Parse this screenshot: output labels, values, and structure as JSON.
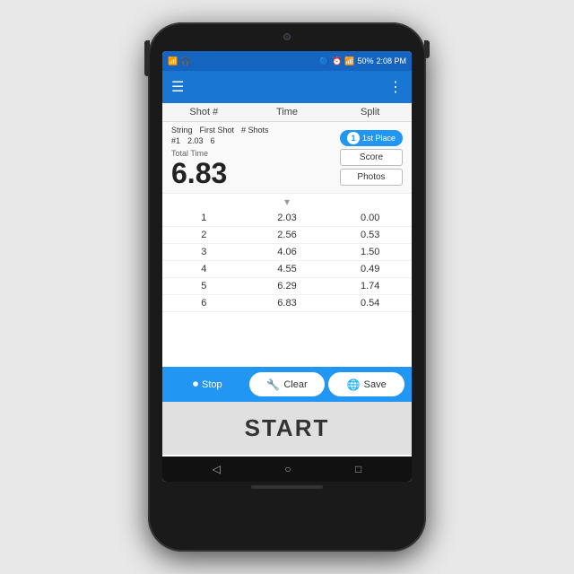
{
  "statusBar": {
    "battery": "50%",
    "time": "2:08 PM",
    "signal": "▮▮▮▮"
  },
  "actionBar": {
    "menuIcon": "☰",
    "moreIcon": "⋮"
  },
  "columnHeaders": {
    "shot": "Shot #",
    "time": "Time",
    "split": "Split"
  },
  "infoRow": {
    "stringLabel": "String",
    "firstShotLabel": "First Shot",
    "shotsLabel": "# Shots",
    "stringValue": "#1",
    "firstShotValue": "2.03",
    "shotsValue": "6",
    "placeNumber": "1",
    "placeText": "1st Place"
  },
  "totalTime": {
    "label": "Total Time",
    "value": "6.83"
  },
  "buttons": {
    "score": "Score",
    "photos": "Photos"
  },
  "shots": [
    {
      "shot": "1",
      "time": "2.03",
      "split": "0.00"
    },
    {
      "shot": "2",
      "time": "2.56",
      "split": "0.53"
    },
    {
      "shot": "3",
      "time": "4.06",
      "split": "1.50"
    },
    {
      "shot": "4",
      "time": "4.55",
      "split": "0.49"
    },
    {
      "shot": "5",
      "time": "6.29",
      "split": "1.74"
    },
    {
      "shot": "6",
      "time": "6.83",
      "split": "0.54"
    }
  ],
  "bottomActions": {
    "stop": "Stop",
    "clear": "Clear",
    "save": "Save"
  },
  "startButton": "START",
  "bottomNav": {
    "back": "◁",
    "home": "○",
    "recent": "□"
  }
}
